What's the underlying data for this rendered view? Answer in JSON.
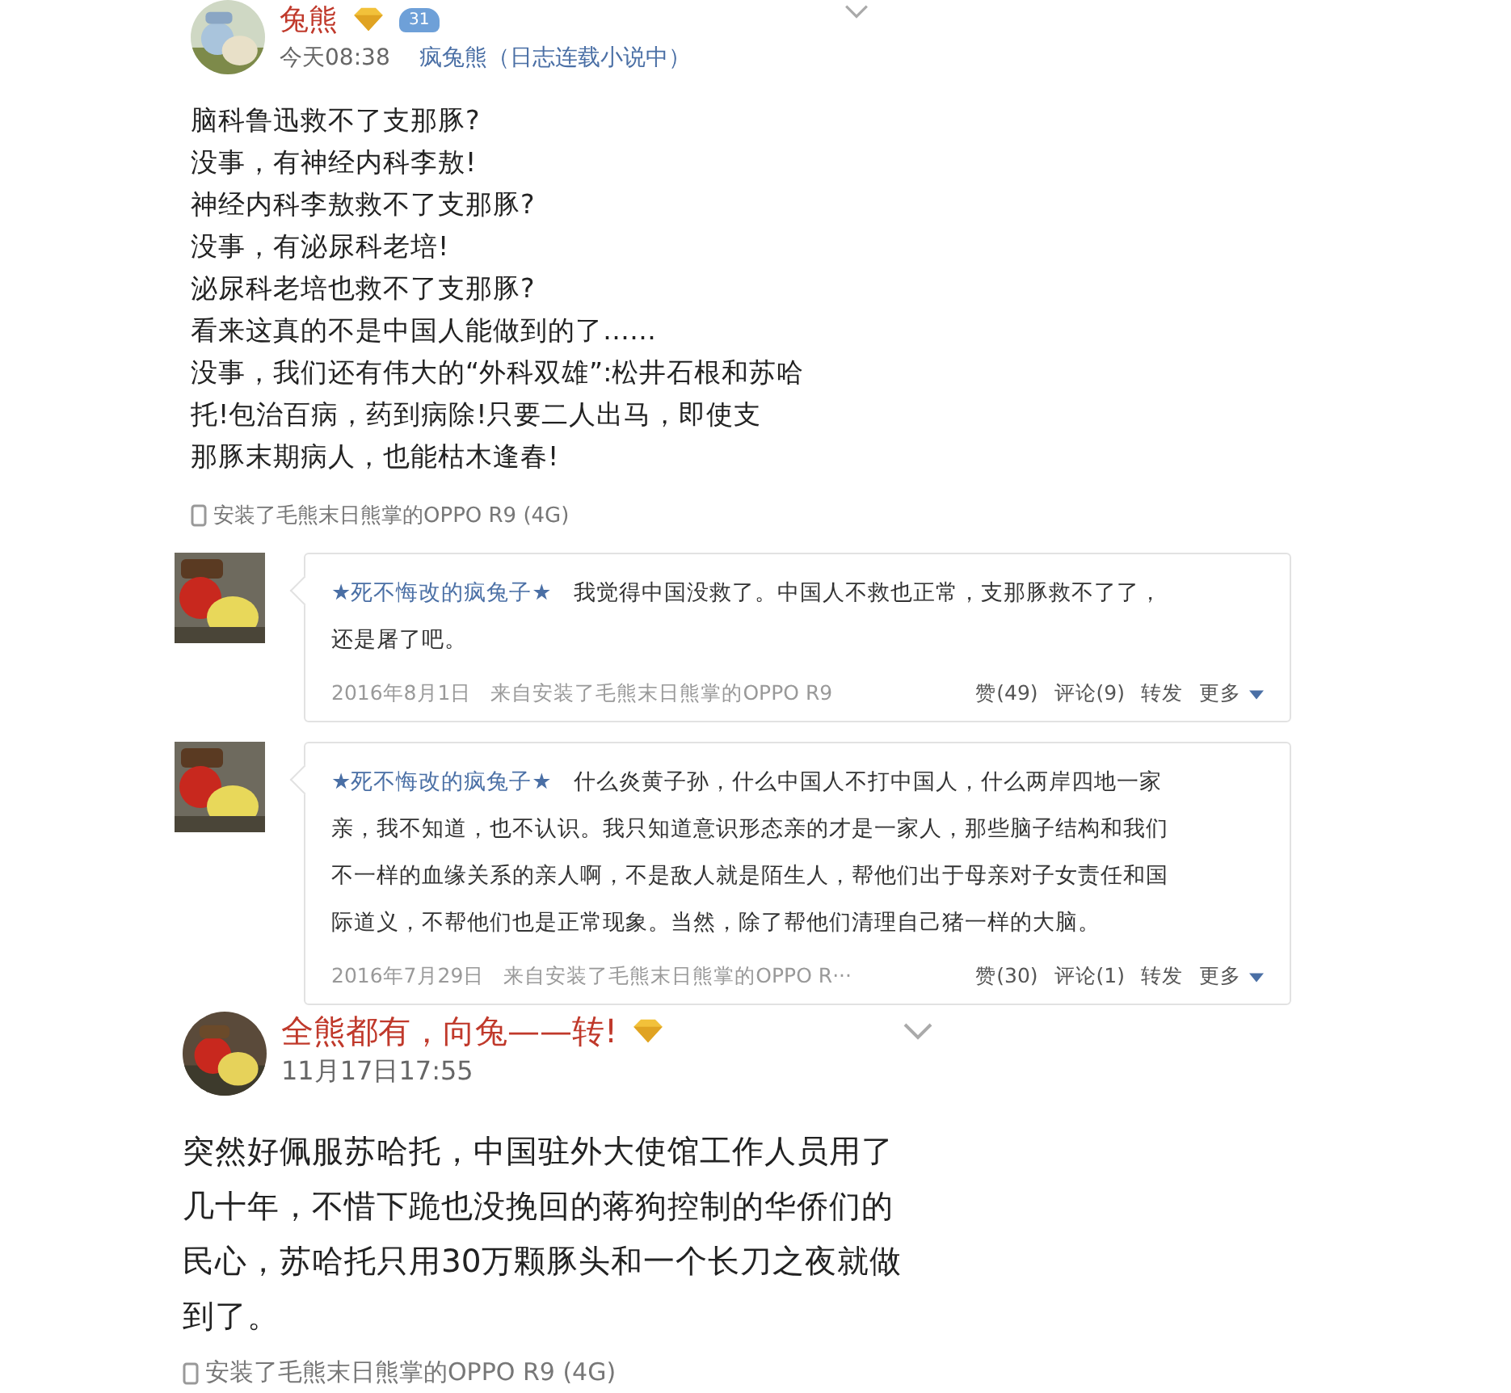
{
  "feed": [
    {
      "kind": "post",
      "name": "兔熊",
      "badges": [
        {
          "kind": "gem"
        },
        {
          "kind": "wings",
          "label": "31"
        }
      ],
      "time": "今天08:38",
      "source": "疯兔熊（日志连载小说中）",
      "lines": [
        "脑科鲁迅救不了支那豚?",
        "没事，有神经内科李敖!",
        "神经内科李敖救不了支那豚?",
        "没事，有泌尿科老培!",
        "泌尿科老培也救不了支那豚?",
        "看来这真的不是中国人能做到的了……",
        "没事，我们还有伟大的“外科双雄”:松井石根和苏哈",
        "托!包治百病，药到病除!只要二人出马，即使支",
        "那豚末期病人，也能枯木逢春!"
      ],
      "device": "安装了毛熊末日熊掌的OPPO R9 (4G)"
    },
    {
      "kind": "comment",
      "name": "★死不悔改的疯兔子★",
      "lines": [
        "我觉得中国没救了。中国人不救也正常，支那豚救不了了，",
        "还是屠了吧。"
      ],
      "date": "2016年8月1日",
      "source": "来自安装了毛熊末日熊掌的OPPO R9",
      "actions": [
        "赞(49)",
        "评论(9)",
        "转发",
        "更多"
      ]
    },
    {
      "kind": "comment",
      "name": "★死不悔改的疯兔子★",
      "lines": [
        "什么炎黄子孙，什么中国人不打中国人，什么两岸四地一家",
        "亲，我不知道，也不认识。我只知道意识形态亲的才是一家人，那些脑子结构和我们",
        "不一样的血缘关系的亲人啊，不是敌人就是陌生人，帮他们出于母亲对子女责任和国",
        "际道义，不帮他们也是正常现象。当然，除了帮他们清理自己猪一样的大脑。"
      ],
      "date": "2016年7月29日",
      "source": "来自安装了毛熊末日熊掌的OPPO R···",
      "actions": [
        "赞(30)",
        "评论(1)",
        "转发",
        "更多"
      ]
    },
    {
      "kind": "post",
      "name": "全熊都有，向兔——转!",
      "badges": [
        {
          "kind": "gem"
        }
      ],
      "time": "11月17日17:55",
      "lines": [
        "突然好佩服苏哈托，中国驻外大使馆工作人员用了",
        "几十年，不惜下跪也没挽回的蒋狗控制的华侨们的",
        "民心，苏哈托只用30万颗豚头和一个长刀之夜就做",
        "到了。"
      ],
      "device": "安装了毛熊末日熊掌的OPPO R9 (4G)"
    }
  ]
}
